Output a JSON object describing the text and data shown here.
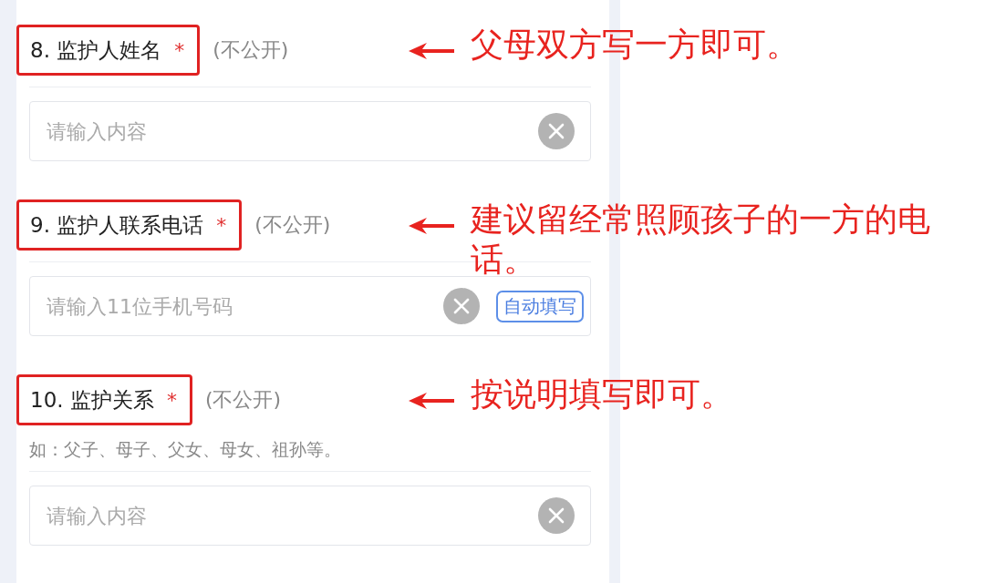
{
  "questions": [
    {
      "title": "8. 监护人姓名",
      "required_mark": "*",
      "privacy": "(不公开)",
      "field": {
        "placeholder": "请输入内容"
      },
      "annotation": "父母双方写一方即可。"
    },
    {
      "title": "9. 监护人联系电话",
      "required_mark": "*",
      "privacy": "(不公开)",
      "field": {
        "placeholder": "请输入11位手机号码",
        "autofill_button": "自动填写"
      },
      "annotation": "建议留经常照顾孩子的一方的电话。"
    },
    {
      "title": "10. 监护关系",
      "required_mark": "*",
      "privacy": "(不公开)",
      "hint": "如：父子、母子、父女、母女、祖孙等。",
      "field": {
        "placeholder": "请输入内容"
      },
      "annotation": "按说明填写即可。"
    }
  ]
}
